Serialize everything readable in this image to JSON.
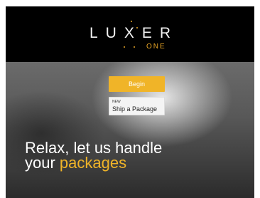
{
  "logo": {
    "word": "LUXER",
    "sub": "ONE"
  },
  "buttons": {
    "begin": "Begin",
    "ship_new": "NEW",
    "ship_label": "Ship a Package"
  },
  "tagline": {
    "line1": "Relax, let us handle",
    "line2_prefix": "your",
    "line2_highlight": "packages"
  },
  "colors": {
    "accent": "#f0b428",
    "header_bg": "#000000"
  }
}
